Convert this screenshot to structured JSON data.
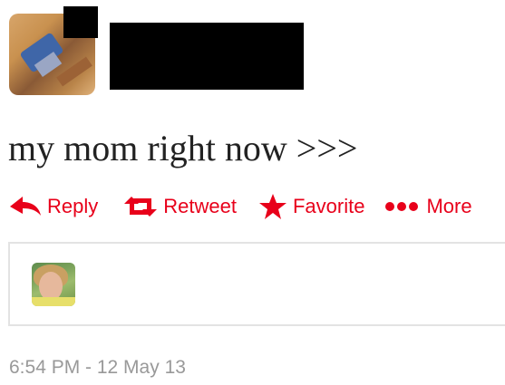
{
  "tweet": {
    "text": "my mom right now >>>",
    "timestamp": "6:54 PM - 12 May 13"
  },
  "actions": {
    "reply": "Reply",
    "retweet": "Retweet",
    "favorite": "Favorite",
    "more": "More"
  },
  "icons": {
    "reply": "reply-arrow-icon",
    "retweet": "retweet-icon",
    "favorite": "star-icon",
    "more": "ellipsis-dots-icon"
  },
  "colors": {
    "action_red": "#e8001a",
    "text": "#222222",
    "timestamp": "#999999",
    "card_border": "#e3e3e3"
  }
}
